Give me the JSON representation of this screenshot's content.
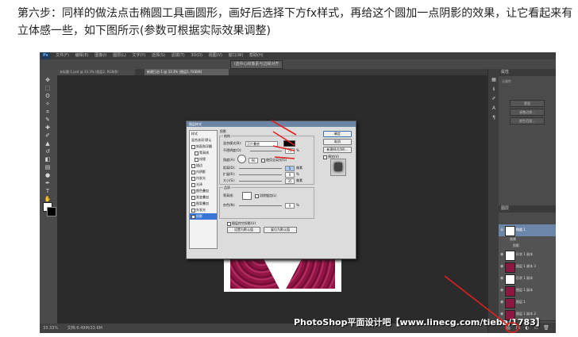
{
  "caption": {
    "line1": "第六步：同样的做法点击椭圆工具画圆形，画好后选择下方fx样式，再给这个圆加一点阴影的效果，让它看起来有",
    "line2": "立体感一些，如下图所示(参数可根据实际效果调整)"
  },
  "ps": {
    "menu": [
      "Ps",
      "文件(F)",
      "编辑(E)",
      "图像(I)",
      "图层(L)",
      "文字(Y)",
      "选择(S)",
      "滤镜(T)",
      "3D(D)",
      "视图(V)",
      "窗口(W)",
      "帮助(H)"
    ],
    "options_center": "i选中心和像素与边缘对齐",
    "tabs": [
      "未标题-1.psd @ 33.3% (图层2, RGB/8)",
      "新建日志-1 @ 33.3% (图层1, RGB/8)"
    ],
    "status_zoom": "33.33%",
    "status_doc": "文档:6.49M/33.6M",
    "watermark": "PhotoShop平面设计吧【www.linecg.com/tieba/1783】"
  },
  "right_panel": {
    "props_header": "属性",
    "props_sub": "无属性",
    "props_btns": [
      "蒙版",
      "调整边缘...",
      "颜色范围..."
    ],
    "layers_header": "图层",
    "layers": [
      {
        "name": "椭圆 1",
        "selected": true
      },
      {
        "name": "效果"
      },
      {
        "name": "投影"
      },
      {
        "name": "形状 1 副本"
      },
      {
        "name": "图层 1 副本 3"
      },
      {
        "name": "形状 1 副本"
      },
      {
        "name": "图层 1 副本"
      },
      {
        "name": "图层 1"
      },
      {
        "name": "图层 1 副本 2"
      }
    ]
  },
  "dialog": {
    "title": "图层样式",
    "styles_list": [
      {
        "label": "样式",
        "check": false
      },
      {
        "label": "混合选项:默认",
        "check": false
      },
      {
        "label": "斜面和浮雕",
        "check": true
      },
      {
        "label": "等高线",
        "check": true
      },
      {
        "label": "纹理",
        "check": true
      },
      {
        "label": "描边",
        "check": true
      },
      {
        "label": "内阴影",
        "check": true
      },
      {
        "label": "内发光",
        "check": true
      },
      {
        "label": "光泽",
        "check": true
      },
      {
        "label": "颜色叠加",
        "check": true
      },
      {
        "label": "渐变叠加",
        "check": true
      },
      {
        "label": "图案叠加",
        "check": true
      },
      {
        "label": "外发光",
        "check": true
      },
      {
        "label": "投影",
        "check": true,
        "active": true
      }
    ],
    "section": "投影",
    "group1": "结构",
    "blend_label": "混合模式(B):",
    "blend_value": "正片叠底",
    "opacity_label": "不透明度(O):",
    "opacity_value": "75",
    "angle_label": "角度(A):",
    "angle_value": "90",
    "global_light": "使用全局光(G)",
    "distance_label": "距离(D):",
    "distance_value": "5",
    "spread_label": "扩展(R):",
    "spread_value": "0",
    "size_label": "大小(S):",
    "size_value": "35",
    "unit_px": "像素",
    "unit_pct": "%",
    "group2": "品质",
    "contour_label": "等高线:",
    "antialias": "消除锯齿(L)",
    "noise_label": "杂色(N):",
    "noise_value": "0",
    "knockout": "图层挖空投影(U)",
    "btn_default": "设置为默认值",
    "btn_reset": "复位为默认值",
    "ok": "确定",
    "cancel": "取消",
    "new_style": "新建样式(W)...",
    "preview": "预览(V)"
  },
  "colors": {
    "accent": "#e02020",
    "ps_dark": "#2b2b2b",
    "selection": "#3875d7",
    "rose": "#a1184c"
  }
}
